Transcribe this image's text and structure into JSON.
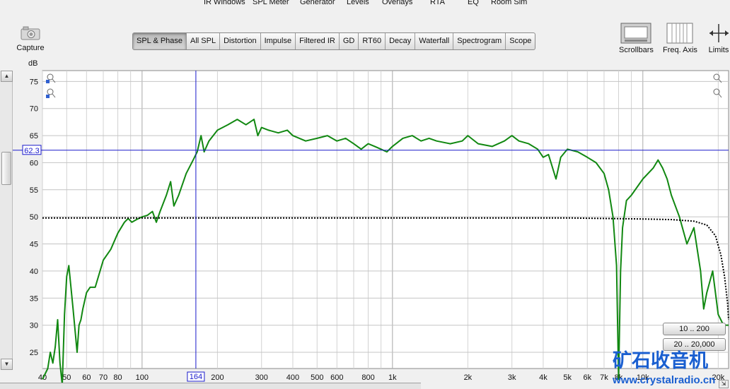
{
  "top_menu": [
    "IR Windows",
    "SPL Meter",
    "Generator",
    "Levels",
    "Overlays",
    "RTA",
    "EQ",
    "Room Sim"
  ],
  "capture_label": "Capture",
  "tabs": [
    {
      "label": "SPL & Phase",
      "active": true
    },
    {
      "label": "All SPL"
    },
    {
      "label": "Distortion"
    },
    {
      "label": "Impulse"
    },
    {
      "label": "Filtered IR"
    },
    {
      "label": "GD"
    },
    {
      "label": "RT60"
    },
    {
      "label": "Decay"
    },
    {
      "label": "Waterfall"
    },
    {
      "label": "Spectrogram"
    },
    {
      "label": "Scope"
    }
  ],
  "tools": {
    "scrollbars": "Scrollbars",
    "freq_axis": "Freq. Axis",
    "limits": "Limits"
  },
  "range_buttons": [
    "10 .. 200",
    "20 .. 20,000"
  ],
  "watermark": {
    "text": "矿石收音机",
    "url": "www.crystalradio.cn"
  },
  "chart_data": {
    "type": "line",
    "ylabel": "dB",
    "xscale": "log",
    "xlim": [
      40,
      22000
    ],
    "ylim": [
      22,
      77
    ],
    "grid": true,
    "x_ticks": [
      {
        "v": 40,
        "l": "40"
      },
      {
        "v": 50,
        "l": "50"
      },
      {
        "v": 60,
        "l": "60"
      },
      {
        "v": 70,
        "l": "70"
      },
      {
        "v": 80,
        "l": "80"
      },
      {
        "v": 100,
        "l": "100"
      },
      {
        "v": 200,
        "l": "200"
      },
      {
        "v": 300,
        "l": "300"
      },
      {
        "v": 400,
        "l": "400"
      },
      {
        "v": 500,
        "l": "500"
      },
      {
        "v": 600,
        "l": "600"
      },
      {
        "v": 800,
        "l": "800"
      },
      {
        "v": 1000,
        "l": "1k"
      },
      {
        "v": 2000,
        "l": "2k"
      },
      {
        "v": 3000,
        "l": "3k"
      },
      {
        "v": 4000,
        "l": "4k"
      },
      {
        "v": 5000,
        "l": "5k"
      },
      {
        "v": 6000,
        "l": "6k"
      },
      {
        "v": 7000,
        "l": "7k"
      },
      {
        "v": 8000,
        "l": "8k"
      },
      {
        "v": 10000,
        "l": "10k"
      },
      {
        "v": 20000,
        "l": "20k"
      }
    ],
    "y_ticks": [
      25,
      30,
      35,
      40,
      45,
      50,
      55,
      60,
      65,
      70,
      75
    ],
    "cursor": {
      "freq": 164,
      "freq_label": "164",
      "level": 62.3,
      "level_label": "62.3"
    },
    "series": [
      {
        "color": "#118811",
        "points": [
          [
            40,
            20
          ],
          [
            42,
            22
          ],
          [
            43,
            25
          ],
          [
            44,
            23
          ],
          [
            45,
            26
          ],
          [
            46,
            31
          ],
          [
            47,
            23
          ],
          [
            48,
            19
          ],
          [
            49,
            32
          ],
          [
            50,
            39
          ],
          [
            51,
            41
          ],
          [
            52,
            37
          ],
          [
            53,
            33
          ],
          [
            55,
            25
          ],
          [
            56,
            30
          ],
          [
            57,
            31
          ],
          [
            58,
            33
          ],
          [
            60,
            36
          ],
          [
            62,
            37
          ],
          [
            65,
            37
          ],
          [
            70,
            42
          ],
          [
            75,
            44
          ],
          [
            80,
            47
          ],
          [
            85,
            49
          ],
          [
            88,
            49.7
          ],
          [
            91,
            49
          ],
          [
            95,
            49.5
          ],
          [
            100,
            50
          ],
          [
            105,
            50.3
          ],
          [
            110,
            51
          ],
          [
            114,
            49
          ],
          [
            118,
            51
          ],
          [
            125,
            54
          ],
          [
            130,
            56.5
          ],
          [
            134,
            52
          ],
          [
            140,
            54
          ],
          [
            150,
            58
          ],
          [
            160,
            60.5
          ],
          [
            166,
            62
          ],
          [
            172,
            65
          ],
          [
            177,
            62
          ],
          [
            185,
            64
          ],
          [
            200,
            66
          ],
          [
            220,
            67
          ],
          [
            240,
            68
          ],
          [
            260,
            67
          ],
          [
            280,
            68
          ],
          [
            290,
            65
          ],
          [
            300,
            66.5
          ],
          [
            320,
            66
          ],
          [
            350,
            65.5
          ],
          [
            380,
            66
          ],
          [
            400,
            65
          ],
          [
            450,
            64
          ],
          [
            500,
            64.5
          ],
          [
            550,
            65
          ],
          [
            600,
            64
          ],
          [
            650,
            64.5
          ],
          [
            700,
            63.5
          ],
          [
            750,
            62.5
          ],
          [
            800,
            63.5
          ],
          [
            850,
            63
          ],
          [
            900,
            62.5
          ],
          [
            950,
            62
          ],
          [
            1000,
            63
          ],
          [
            1100,
            64.5
          ],
          [
            1200,
            65
          ],
          [
            1300,
            64
          ],
          [
            1400,
            64.5
          ],
          [
            1500,
            64
          ],
          [
            1700,
            63.5
          ],
          [
            1900,
            64
          ],
          [
            2000,
            65
          ],
          [
            2200,
            63.5
          ],
          [
            2500,
            63
          ],
          [
            2800,
            64
          ],
          [
            3000,
            65
          ],
          [
            3200,
            64
          ],
          [
            3500,
            63.5
          ],
          [
            3800,
            62.5
          ],
          [
            4000,
            61
          ],
          [
            4200,
            61.5
          ],
          [
            4500,
            57
          ],
          [
            4700,
            61
          ],
          [
            5000,
            62.5
          ],
          [
            5500,
            62
          ],
          [
            6000,
            61
          ],
          [
            6500,
            60
          ],
          [
            7000,
            58
          ],
          [
            7300,
            55
          ],
          [
            7600,
            50
          ],
          [
            7850,
            41
          ],
          [
            8000,
            20
          ],
          [
            8150,
            40
          ],
          [
            8300,
            48
          ],
          [
            8600,
            53
          ],
          [
            9000,
            54
          ],
          [
            10000,
            57
          ],
          [
            11000,
            59
          ],
          [
            11500,
            60.5
          ],
          [
            12000,
            59
          ],
          [
            12500,
            57
          ],
          [
            13000,
            54
          ],
          [
            14000,
            50
          ],
          [
            15000,
            45
          ],
          [
            16000,
            48
          ],
          [
            17000,
            40
          ],
          [
            17500,
            33
          ],
          [
            18000,
            36
          ],
          [
            19000,
            40
          ],
          [
            20000,
            32
          ],
          [
            21000,
            30
          ],
          [
            22000,
            30
          ]
        ]
      },
      {
        "color": "#000000",
        "dotted": true,
        "points": [
          [
            40,
            49.8
          ],
          [
            100,
            49.8
          ],
          [
            1000,
            49.8
          ],
          [
            5000,
            49.8
          ],
          [
            10000,
            49.6
          ],
          [
            13000,
            49.5
          ],
          [
            16000,
            49.2
          ],
          [
            18000,
            48.5
          ],
          [
            19500,
            46.5
          ],
          [
            20500,
            43
          ],
          [
            21200,
            39
          ],
          [
            21800,
            34
          ],
          [
            22000,
            31
          ]
        ]
      }
    ]
  }
}
